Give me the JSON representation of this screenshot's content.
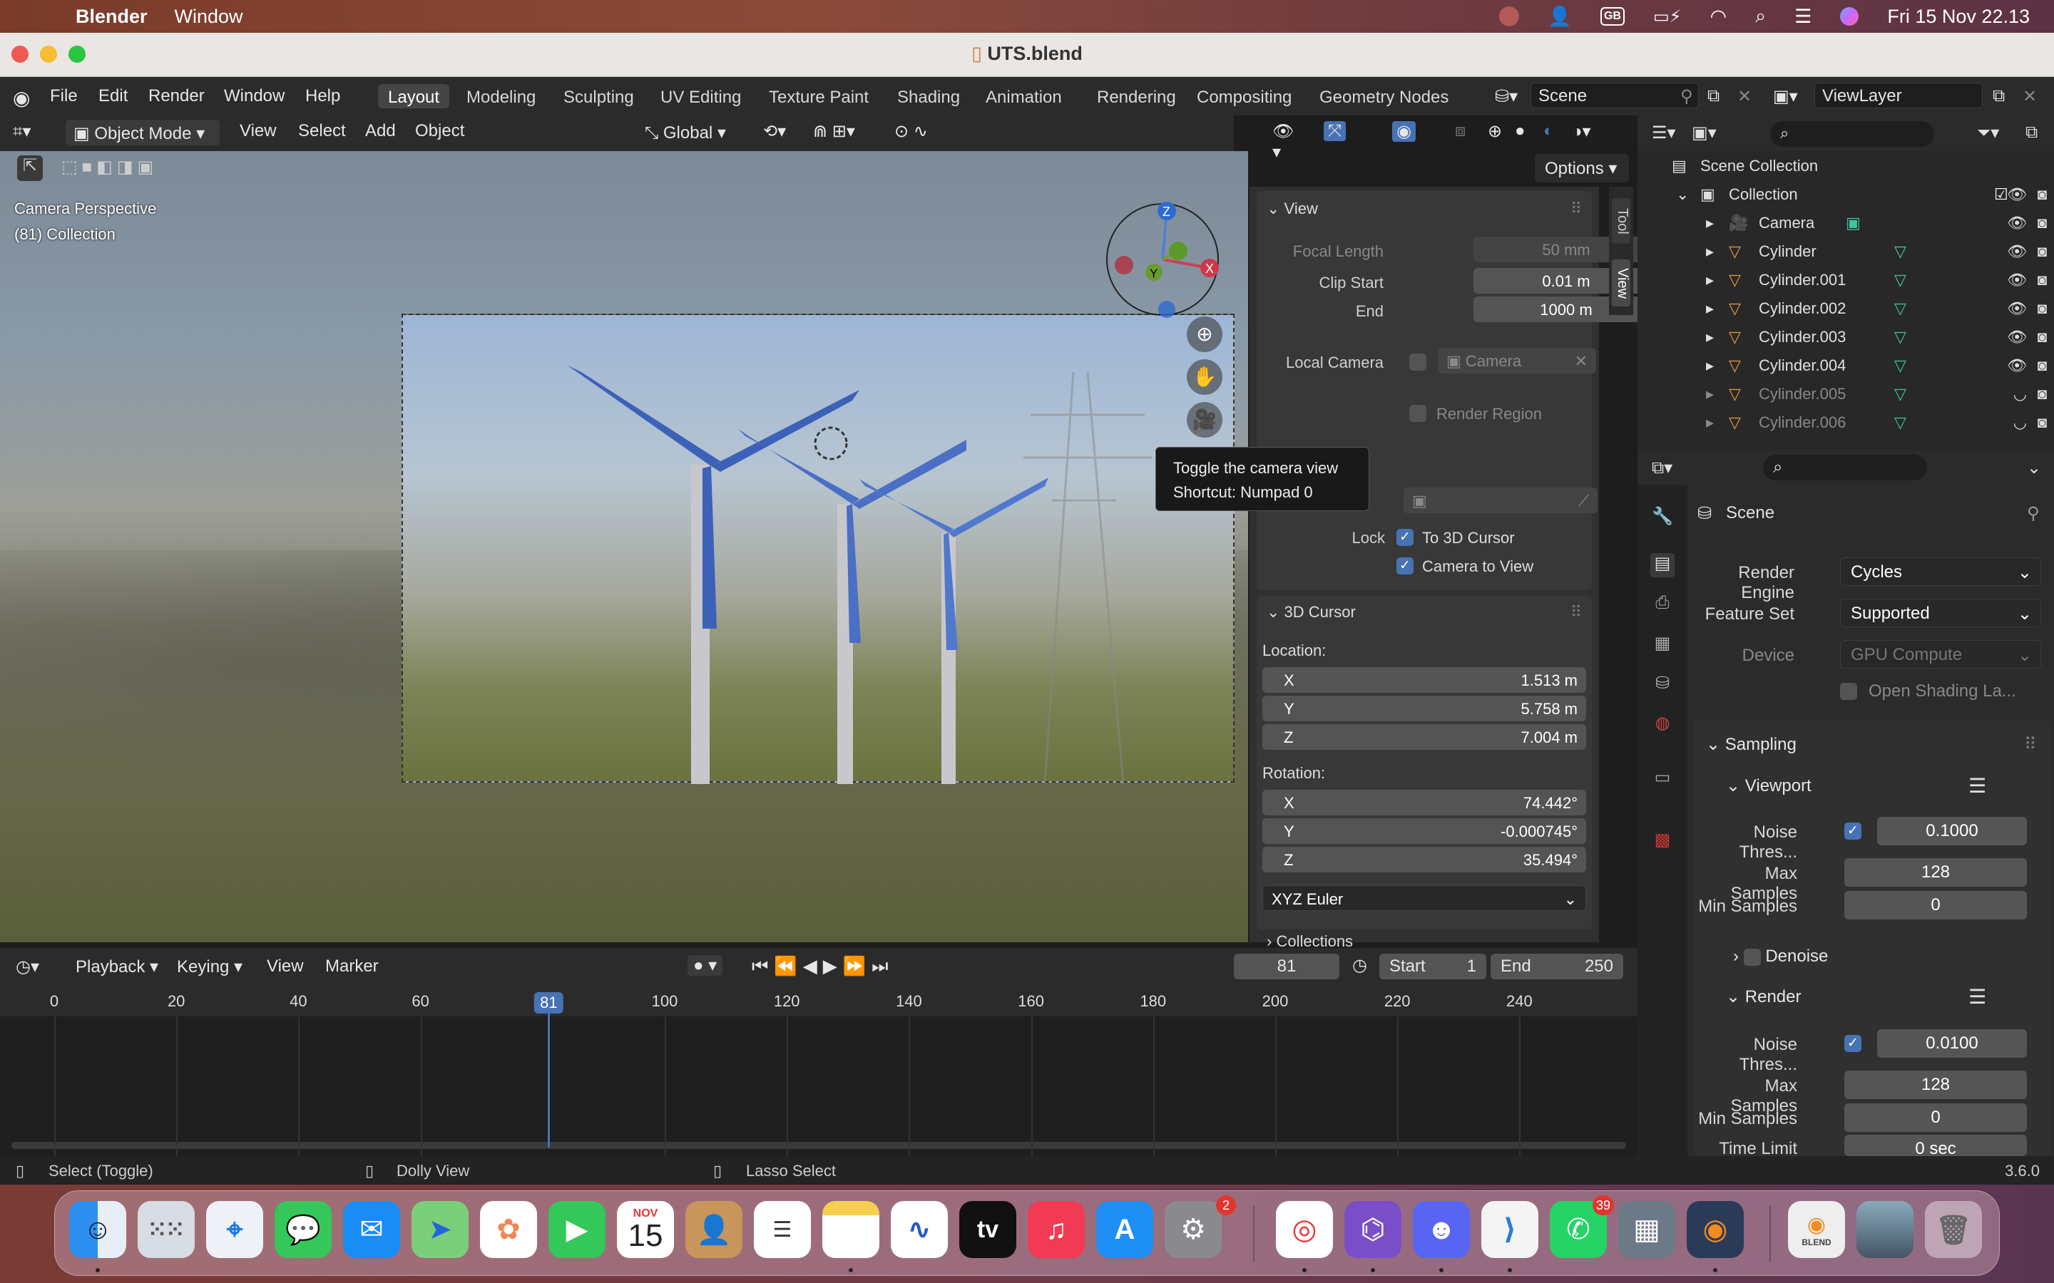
{
  "menubar": {
    "app": "Blender",
    "items": [
      "Window"
    ],
    "input_source": "GB",
    "datetime": "Fri 15 Nov  22.13"
  },
  "window": {
    "title": "UTS.blend"
  },
  "topbar": {
    "menus": [
      "File",
      "Edit",
      "Render",
      "Window",
      "Help"
    ],
    "workspaces": [
      "Layout",
      "Modeling",
      "Sculpting",
      "UV Editing",
      "Texture Paint",
      "Shading",
      "Animation",
      "Rendering",
      "Compositing",
      "Geometry Nodes"
    ],
    "active_workspace": "Layout",
    "scene": "Scene",
    "view_layer": "ViewLayer"
  },
  "viewport_header": {
    "mode": "Object Mode",
    "menus": [
      "View",
      "Select",
      "Add",
      "Object"
    ],
    "transform_orientation": "Global",
    "options": "Options"
  },
  "viewport": {
    "perspective": "Camera Perspective",
    "collection": "(81) Collection",
    "gizmo": {
      "z": "Z",
      "y": "Y",
      "x": "X"
    }
  },
  "tooltip": {
    "title": "Toggle the camera view",
    "shortcut": "Shortcut: Numpad 0"
  },
  "npanel": {
    "tabs": [
      "Tool",
      "View"
    ],
    "view": {
      "header": "View",
      "focal_length_label": "Focal Length",
      "focal_length": "50 mm",
      "clip_start_label": "Clip Start",
      "clip_start": "0.01 m",
      "end_label": "End",
      "end": "1000 m",
      "local_camera_label": "Local Camera",
      "local_camera": "Camera",
      "render_region": "Render Region",
      "partial_label": "t",
      "lock_label": "Lock",
      "lock_3d_cursor": "To 3D Cursor",
      "lock_camera": "Camera to View"
    },
    "cursor": {
      "header": "3D Cursor",
      "location_label": "Location:",
      "loc": [
        {
          "axis": "X",
          "value": "1.513 m"
        },
        {
          "axis": "Y",
          "value": "5.758 m"
        },
        {
          "axis": "Z",
          "value": "7.004 m"
        }
      ],
      "rotation_label": "Rotation:",
      "rot": [
        {
          "axis": "X",
          "value": "74.442°"
        },
        {
          "axis": "Y",
          "value": "-0.000745°"
        },
        {
          "axis": "Z",
          "value": "35.494°"
        }
      ],
      "mode": "XYZ Euler"
    },
    "collections": "Collections"
  },
  "outliner": {
    "scene_collection": "Scene Collection",
    "collection": "Collection",
    "items": [
      "Camera",
      "Cylinder",
      "Cylinder.001",
      "Cylinder.002",
      "Cylinder.003",
      "Cylinder.004",
      "Cylinder.005",
      "Cylinder.006"
    ]
  },
  "properties": {
    "context": "Scene",
    "render_engine_label": "Render Engine",
    "render_engine": "Cycles",
    "feature_set_label": "Feature Set",
    "feature_set": "Supported",
    "device_label": "Device",
    "device": "GPU Compute",
    "open_shading": "Open Shading La...",
    "sampling": "Sampling",
    "viewport": "Viewport",
    "vp_noise_label": "Noise Thres...",
    "vp_noise": "0.1000",
    "vp_max_label": "Max Samples",
    "vp_max": "128",
    "vp_min_label": "Min Samples",
    "vp_min": "0",
    "denoise": "Denoise",
    "render": "Render",
    "r_noise_label": "Noise Thres...",
    "r_noise": "0.0100",
    "r_max_label": "Max Samples",
    "r_max": "128",
    "r_min_label": "Min Samples",
    "r_min": "0",
    "time_limit_label": "Time Limit",
    "time_limit": "0 sec"
  },
  "timeline": {
    "menus": [
      "Playback",
      "Keying",
      "View",
      "Marker"
    ],
    "current_frame": "81",
    "start_label": "Start",
    "start": "1",
    "end_label": "End",
    "end": "250",
    "ticks": [
      "0",
      "20",
      "40",
      "60",
      "81",
      "100",
      "120",
      "140",
      "160",
      "180",
      "200",
      "220",
      "240"
    ]
  },
  "statusbar": {
    "select": "Select (Toggle)",
    "dolly": "Dolly View",
    "lasso": "Lasso Select",
    "version": "3.6.0"
  },
  "dock": {
    "calendar_month": "NOV",
    "calendar_day": "15",
    "settings_badge": "2",
    "whatsapp_badge": "39",
    "appletv": "tv",
    "blend_label": "BLEND"
  }
}
